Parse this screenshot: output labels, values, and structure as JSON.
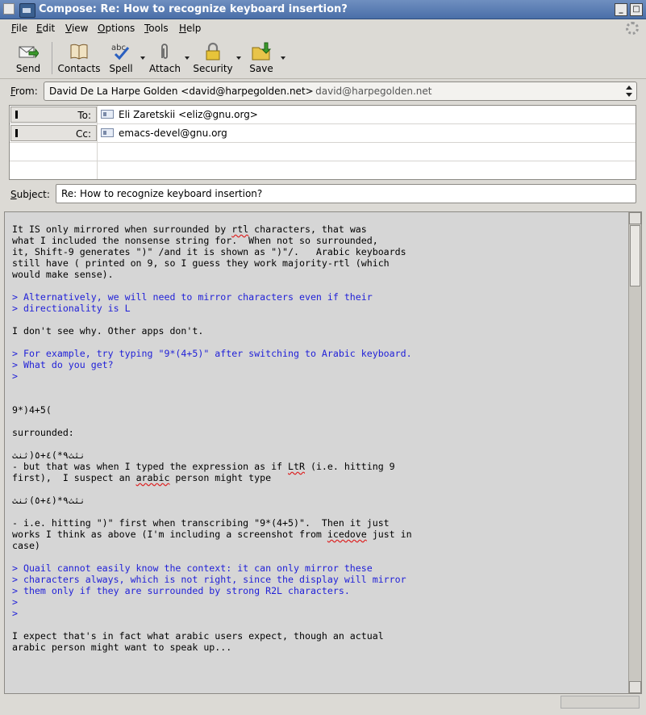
{
  "window": {
    "title": "Compose: Re: How to recognize keyboard insertion?"
  },
  "menu": [
    {
      "label": "File",
      "key": "F",
      "rest": "ile"
    },
    {
      "label": "Edit",
      "key": "E",
      "rest": "dit"
    },
    {
      "label": "View",
      "key": "V",
      "rest": "iew"
    },
    {
      "label": "Options",
      "key": "O",
      "rest": "ptions"
    },
    {
      "label": "Tools",
      "key": "T",
      "rest": "ools"
    },
    {
      "label": "Help",
      "key": "H",
      "rest": "elp"
    }
  ],
  "toolbar": {
    "send": "Send",
    "contacts": "Contacts",
    "spell": "Spell",
    "attach": "Attach",
    "security": "Security",
    "save": "Save"
  },
  "from": {
    "label_key": "F",
    "label_rest": "rom:",
    "value": "David De La Harpe Golden <david@harpegolden.net>",
    "extra": "- david@harpegolden.net"
  },
  "recipients": [
    {
      "type": "To:",
      "value": "Eli Zaretskii <eliz@gnu.org>"
    },
    {
      "type": "Cc:",
      "value": "emacs-devel@gnu.org"
    }
  ],
  "subject": {
    "label_key": "S",
    "label_rest": "ubject:",
    "value": "Re: How to recognize keyboard insertion?"
  },
  "colors": {
    "quote": "#1f1fd8",
    "titlebar": "#4a6fa8",
    "body_bg": "#d6d6d6"
  }
}
